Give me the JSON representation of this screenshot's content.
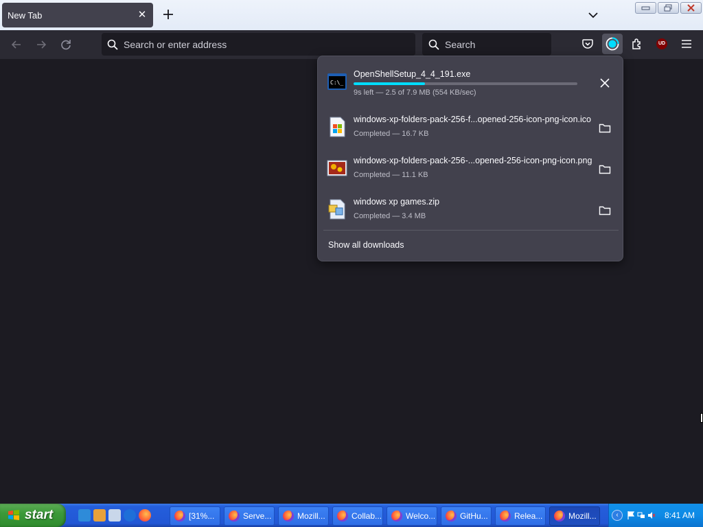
{
  "browser": {
    "tab": {
      "title": "New Tab",
      "close_icon": "close-icon"
    },
    "newtab_icon": "plus-icon",
    "tablist_icon": "chevron-down-icon",
    "urlbar": {
      "placeholder": "Search or enter address"
    },
    "searchbar": {
      "placeholder": "Search"
    }
  },
  "downloads": {
    "items": [
      {
        "name": "OpenShellSetup_4_4_191.exe",
        "status": "9s left — 2.5 of 7.9 MB (554 KB/sec)",
        "progress": 0.32,
        "action_icon": "cancel-icon",
        "file_icon": "console-app-icon"
      },
      {
        "name": "windows-xp-folders-pack-256-f...opened-256-icon-png-icon.ico",
        "status": "Completed — 16.7 KB",
        "action_icon": "folder-icon",
        "file_icon": "windows-logo-file-icon"
      },
      {
        "name": "windows-xp-folders-pack-256-...opened-256-icon-png-icon.png",
        "status": "Completed — 11.1 KB",
        "action_icon": "folder-icon",
        "file_icon": "image-file-icon"
      },
      {
        "name": "windows xp games.zip",
        "status": "Completed — 3.4 MB",
        "action_icon": "folder-icon",
        "file_icon": "zip-file-icon"
      }
    ],
    "show_all": "Show all downloads"
  },
  "taskbar": {
    "start_label": "start",
    "tasks": [
      "[31%...",
      "Serve...",
      "Mozill...",
      "Collab...",
      "Welco...",
      "GitHu...",
      "Relea...",
      "Mozill..."
    ],
    "clock": "8:41 AM"
  },
  "colors": {
    "accent": "#00ddff",
    "panel_bg": "#42414d",
    "toolbar_bg": "#2b2a33",
    "content_bg": "#1c1b22",
    "taskbar_blue": "#245edb",
    "start_green": "#3c9a3a"
  }
}
